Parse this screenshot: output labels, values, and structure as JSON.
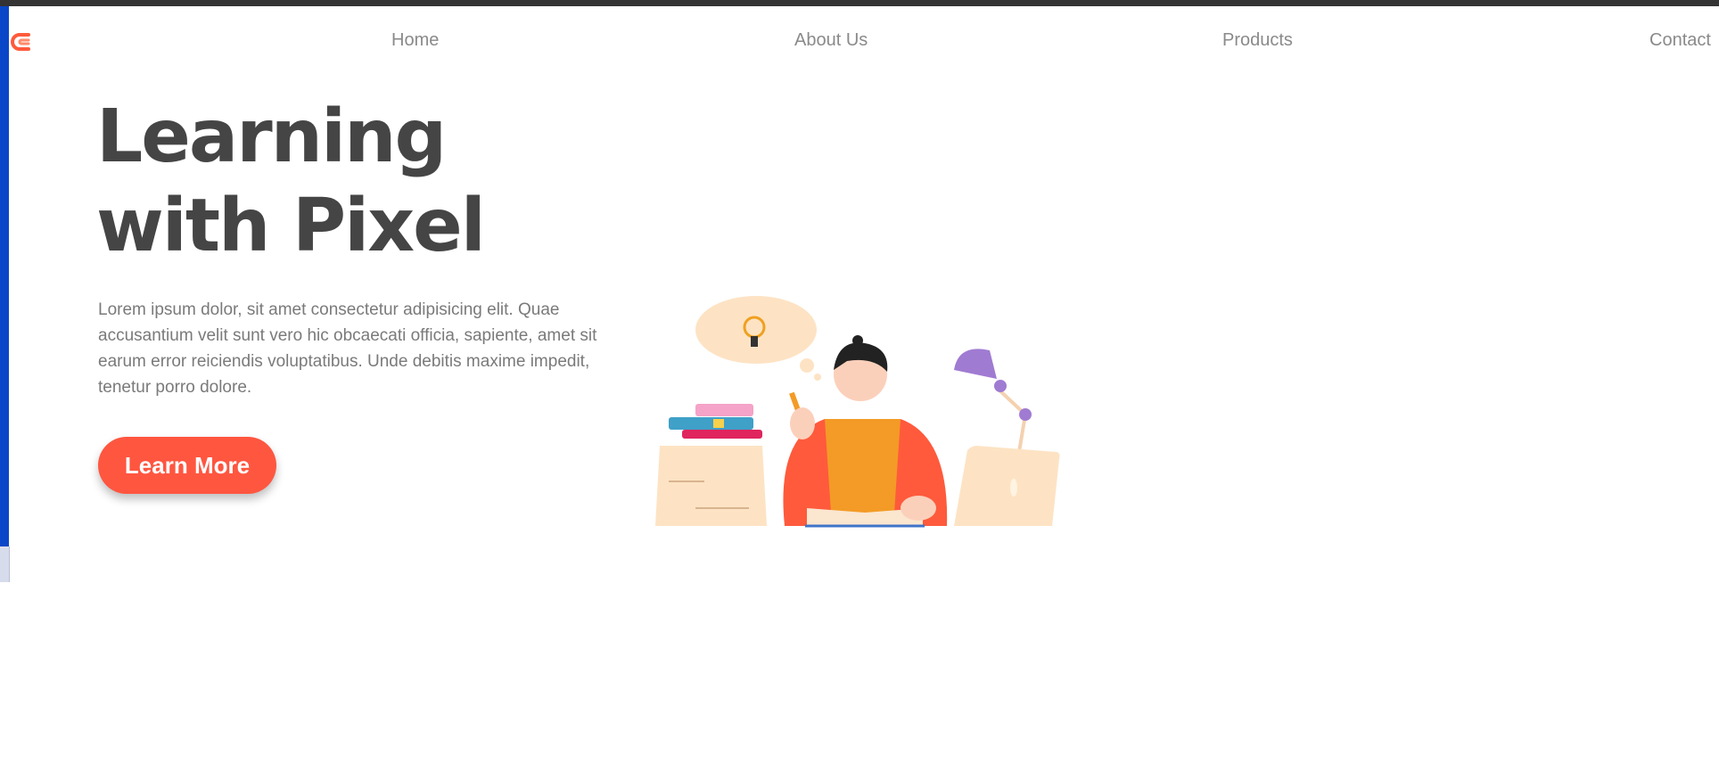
{
  "nav": {
    "logo_icon": "c-arrow-logo-icon",
    "items": [
      {
        "label": "Home"
      },
      {
        "label": "About Us"
      },
      {
        "label": "Products"
      },
      {
        "label": "Contact"
      }
    ]
  },
  "hero": {
    "title_line1": "Learning",
    "title_line2": "with Pixel",
    "description": "Lorem ipsum dolor, sit amet consectetur adipisicing elit. Quae accusantium velit sunt vero hic obcaecati officia, sapiente, amet sit earum error reiciendis voluptatibus. Unde debitis maxime impedit, tenetur porro dolore.",
    "cta_label": "Learn More",
    "illustration_icon": "student-studying-illustration"
  },
  "colors": {
    "accent": "#ff5640",
    "heading": "#454545",
    "nav_text": "#8a8a8a",
    "body_text": "#7a7a7a",
    "topbar": "#343434"
  }
}
